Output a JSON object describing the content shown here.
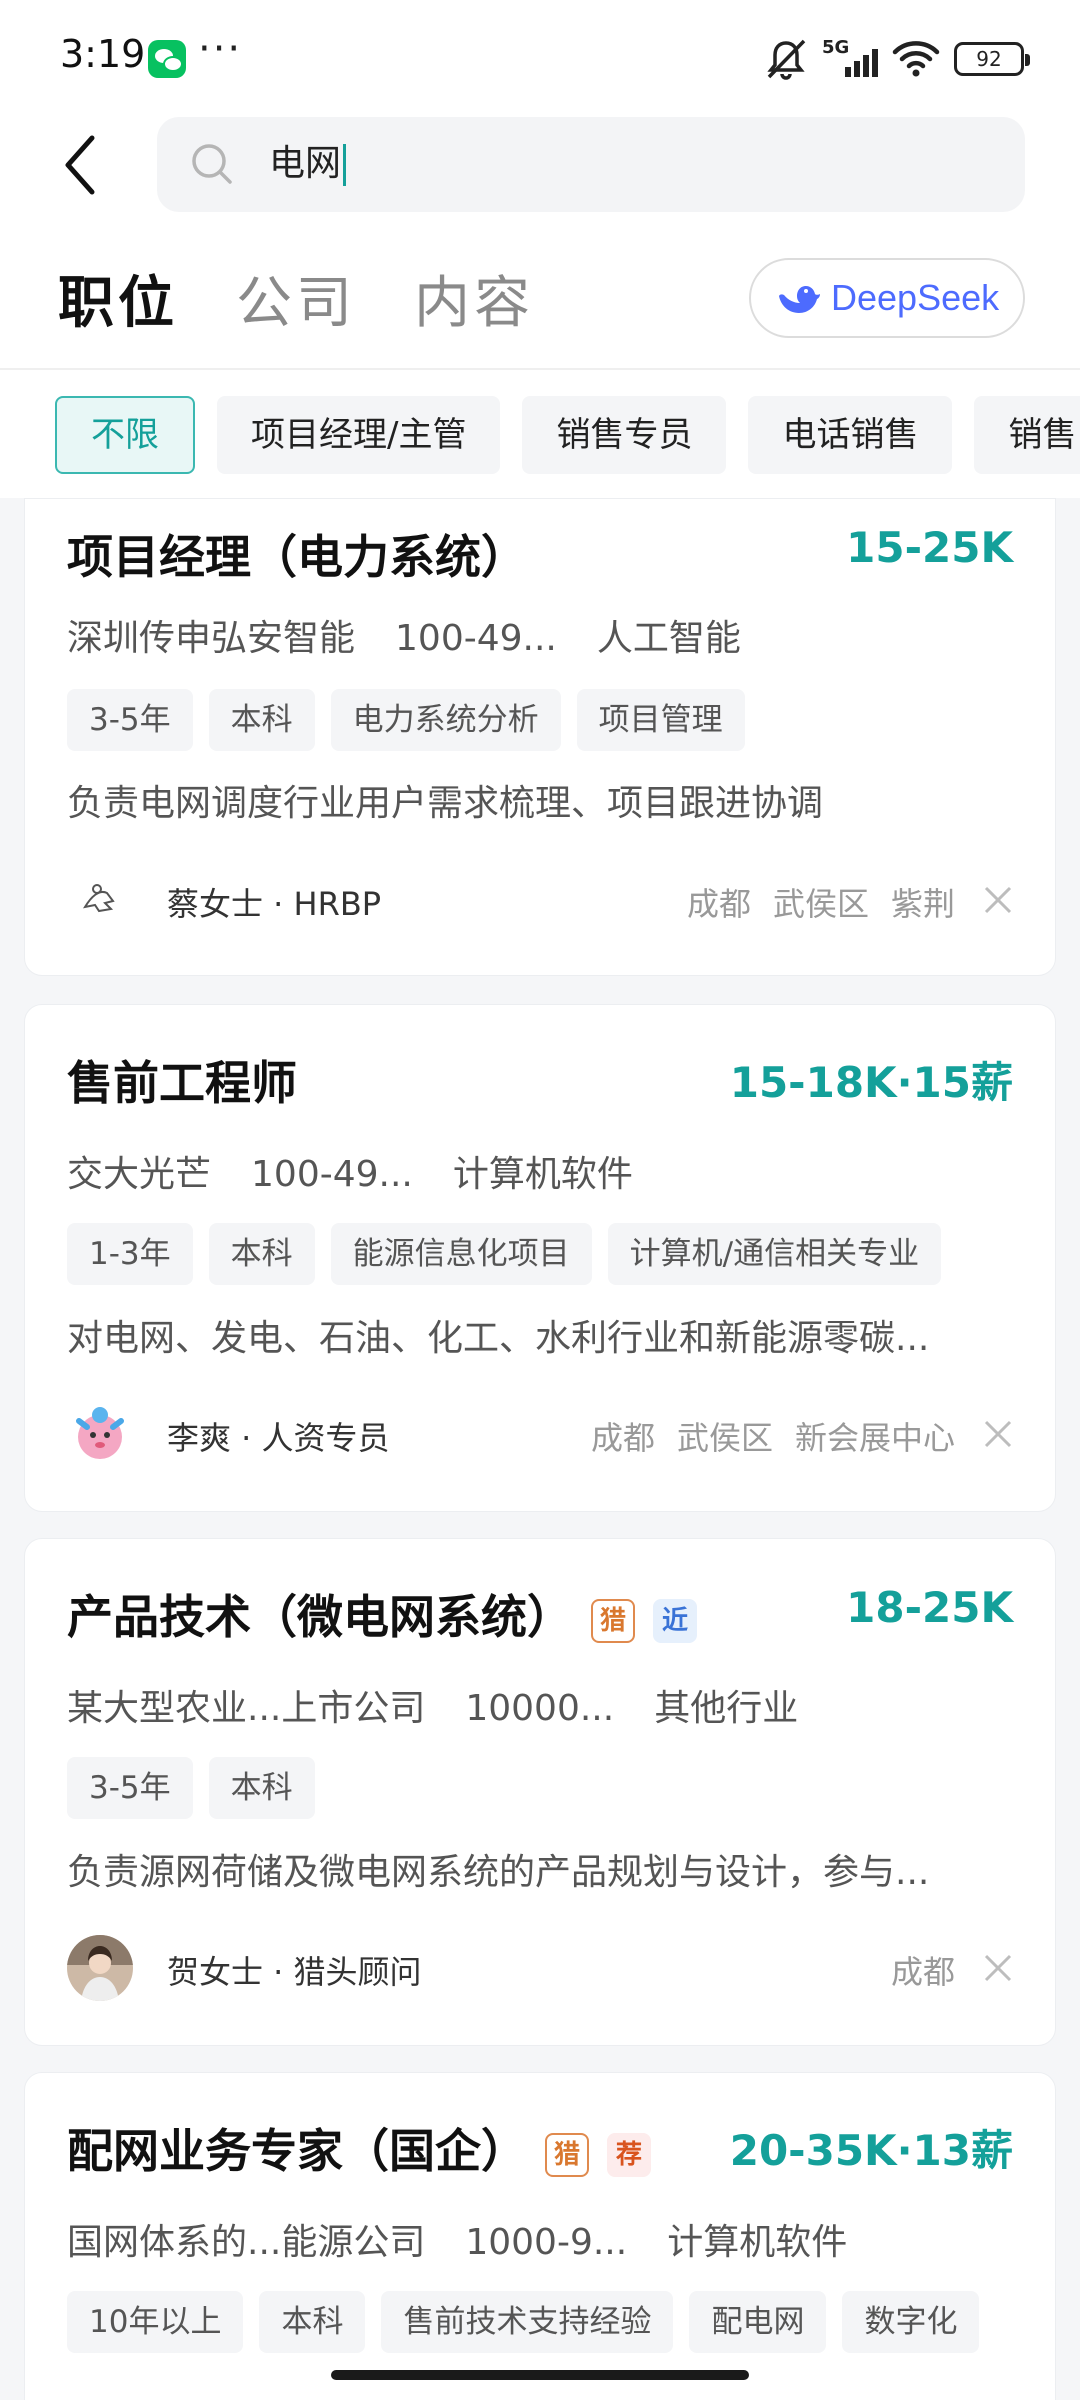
{
  "status_bar": {
    "time": "3:19",
    "more": "···",
    "network": "5G",
    "battery": "92"
  },
  "search": {
    "value": "电网"
  },
  "tabs": [
    {
      "label": "职位"
    },
    {
      "label": "公司"
    },
    {
      "label": "内容"
    }
  ],
  "deepseek": {
    "label": "DeepSeek"
  },
  "filters": [
    {
      "label": "不限"
    },
    {
      "label": "项目经理/主管"
    },
    {
      "label": "销售专员"
    },
    {
      "label": "电话销售"
    },
    {
      "label": "销售"
    }
  ],
  "jobs": [
    {
      "title": "项目经理（电力系统）",
      "salary": "15-25K",
      "company": "深圳传申弘安智能",
      "size": "100-49...",
      "industry": "人工智能",
      "tags": [
        "3-5年",
        "本科",
        "电力系统分析",
        "项目管理"
      ],
      "desc": "负责电网调度行业用户需求梳理、项目跟进协调",
      "recruiter": "蔡女士 · HRBP",
      "location": [
        "成都",
        "武侯区",
        "紫荆"
      ]
    },
    {
      "title": "售前工程师",
      "salary": "15-18K·15薪",
      "company": "交大光芒",
      "size": "100-49...",
      "industry": "计算机软件",
      "tags": [
        "1-3年",
        "本科",
        "能源信息化项目",
        "计算机/通信相关专业"
      ],
      "desc": "对电网、发电、石油、化工、水利行业和新能源零碳...",
      "recruiter": "李爽 · 人资专员",
      "location": [
        "成都",
        "武侯区",
        "新会展中心"
      ]
    },
    {
      "title": "产品技术（微电网系统）",
      "badges": [
        "猎",
        "近"
      ],
      "salary": "18-25K",
      "company": "某大型农业...上市公司",
      "size": "10000...",
      "industry": "其他行业",
      "tags": [
        "3-5年",
        "本科"
      ],
      "desc": "负责源网荷储及微电网系统的产品规划与设计，参与...",
      "recruiter": "贺女士 · 猎头顾问",
      "location": [
        "成都"
      ]
    },
    {
      "title": "配网业务专家（国企）",
      "badges": [
        "猎",
        "荐"
      ],
      "salary": "20-35K·13薪",
      "company": "国网体系的...能源公司",
      "size": "1000-9...",
      "industry": "计算机软件",
      "tags": [
        "10年以上",
        "本科",
        "售前技术支持经验",
        "配电网",
        "数字化"
      ]
    }
  ]
}
